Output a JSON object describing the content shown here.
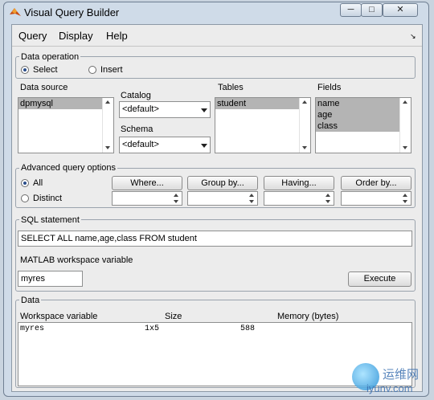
{
  "window": {
    "title": "Visual Query Builder"
  },
  "menu": [
    "Query",
    "Display",
    "Help"
  ],
  "data_operation": {
    "legend": "Data operation",
    "options": [
      "Select",
      "Insert"
    ],
    "selected": "Select"
  },
  "data_source": {
    "label": "Data source",
    "items": [
      "dpmysql"
    ],
    "selected": "dpmysql"
  },
  "catalog": {
    "label": "Catalog",
    "value": "<default>"
  },
  "schema": {
    "label": "Schema",
    "value": "<default>"
  },
  "tables": {
    "label": "Tables",
    "items": [
      "student"
    ],
    "selected": "student"
  },
  "fields": {
    "label": "Fields",
    "items": [
      "name",
      "age",
      "class"
    ]
  },
  "advanced": {
    "legend": "Advanced query options",
    "options": [
      "All",
      "Distinct"
    ],
    "selected": "All",
    "buttons": [
      "Where...",
      "Group by...",
      "Having...",
      "Order by..."
    ]
  },
  "sql": {
    "legend": "SQL statement",
    "statement": "SELECT ALL name,age,class FROM student"
  },
  "workspace_var": {
    "label": "MATLAB workspace variable",
    "value": "myres"
  },
  "execute_label": "Execute",
  "data_panel": {
    "legend": "Data",
    "columns": [
      "Workspace variable",
      "Size",
      "Memory (bytes)"
    ],
    "rows": [
      {
        "name": "myres",
        "size": "1x5",
        "memory": "588"
      }
    ]
  },
  "watermark": {
    "text1": "运维网",
    "text2": "iyunv.com"
  },
  "colors": {
    "selection": "#b4b4b4",
    "frame": "#cfdbe8",
    "panel_bg": "#ececec"
  }
}
